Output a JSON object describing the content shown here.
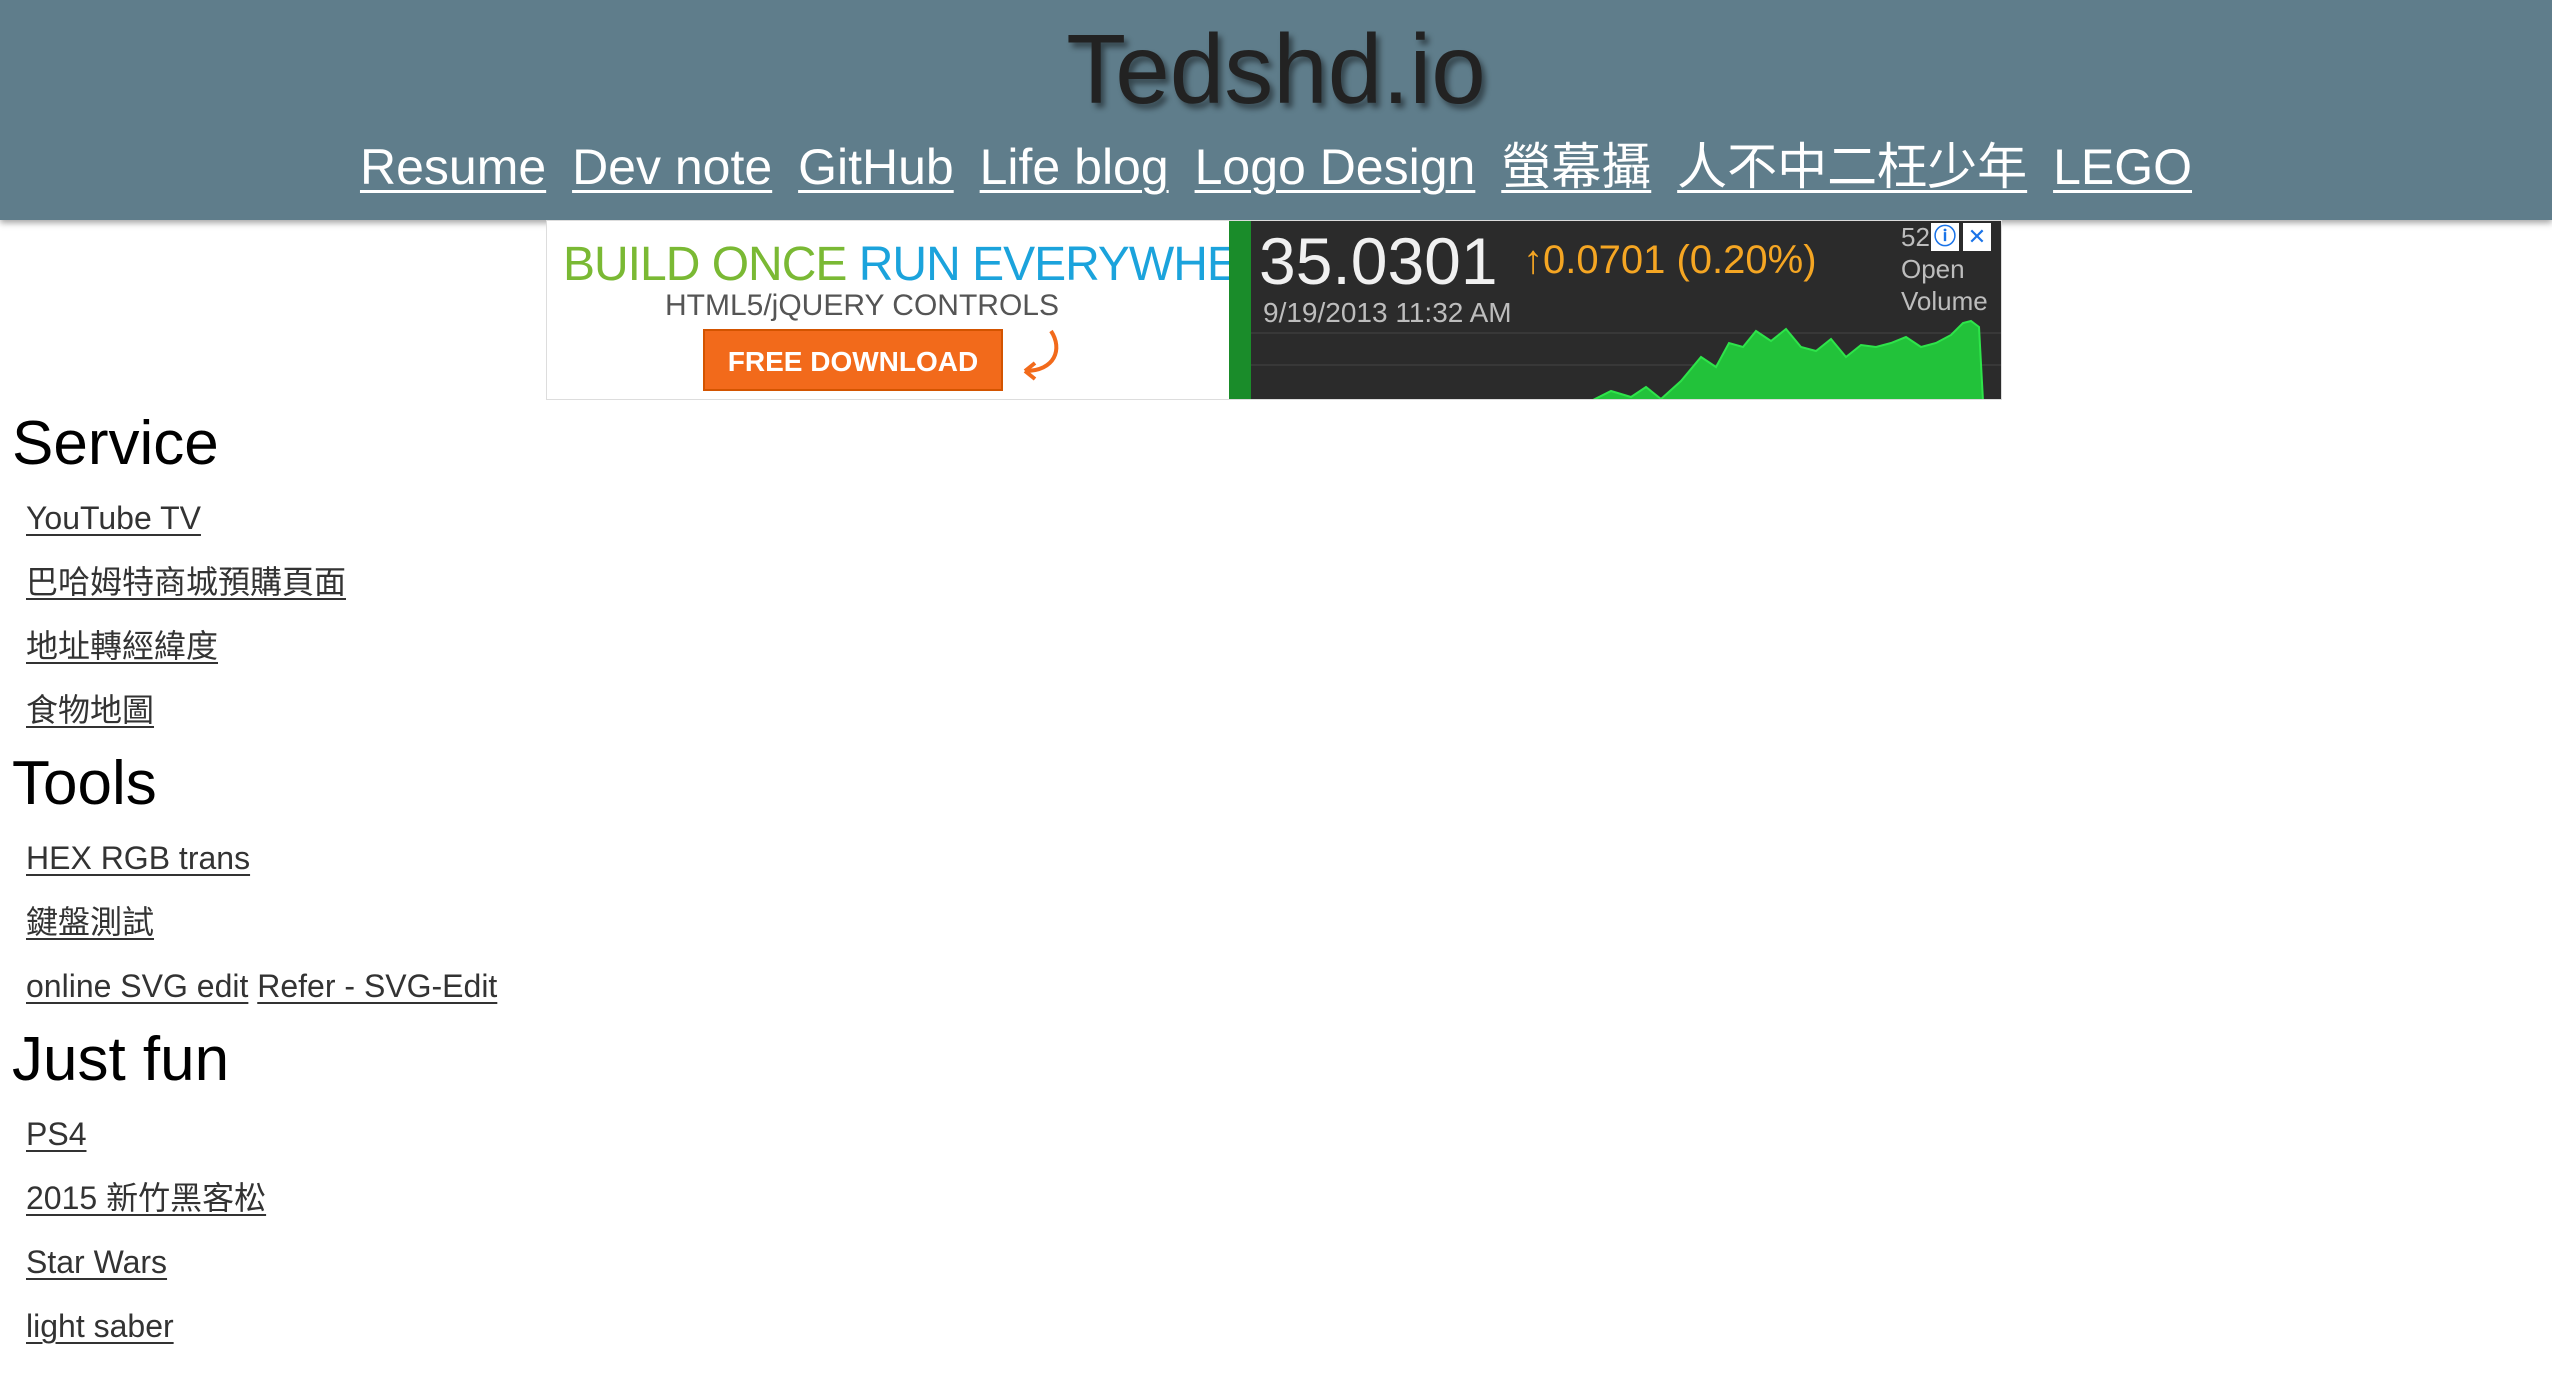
{
  "header": {
    "title": "Tedshd.io",
    "nav": [
      "Resume",
      "Dev note",
      "GitHub",
      "Life blog",
      "Logo Design",
      "螢幕攝",
      "人不中二枉少年",
      "LEGO"
    ]
  },
  "ad": {
    "headline_part1": "BUILD ONCE ",
    "headline_part2": "RUN EVERYWHERE",
    "subline": "HTML5/jQUERY CONTROLS",
    "button_label": "FREE DOWNLOAD",
    "price": "35.0301",
    "change": "↑0.0701 (0.20%)",
    "date": "9/19/2013 11:32 AM",
    "stat_value": "52",
    "stat_label_1": "Open",
    "stat_label_2": "Volume",
    "info_icon": "ⓘ",
    "close_icon": "✕",
    "colors": {
      "green": "#7ab934",
      "blue": "#1ba3dc",
      "orange": "#f26a1b",
      "chart_green": "#22c23a"
    }
  },
  "sections": [
    {
      "title": "Service",
      "items": [
        [
          "YouTube TV"
        ],
        [
          "巴哈姆特商城預購頁面"
        ],
        [
          "地址轉經緯度"
        ],
        [
          "食物地圖"
        ]
      ]
    },
    {
      "title": "Tools",
      "items": [
        [
          "HEX RGB trans"
        ],
        [
          "鍵盤測試"
        ],
        [
          "online SVG edit",
          "Refer - SVG-Edit"
        ]
      ]
    },
    {
      "title": "Just fun",
      "items": [
        [
          "PS4"
        ],
        [
          "2015 新竹黑客松"
        ],
        [
          "Star Wars"
        ],
        [
          "light saber"
        ]
      ]
    }
  ]
}
